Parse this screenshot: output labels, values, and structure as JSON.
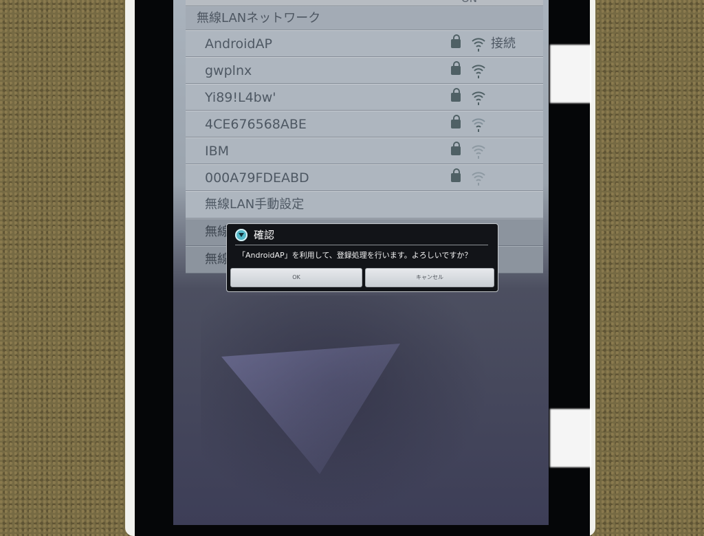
{
  "status": {
    "top_value": "ON"
  },
  "wifi_section": {
    "header": "無線LANネットワーク"
  },
  "networks": [
    {
      "name": "AndroidAP",
      "status": "接続"
    },
    {
      "name": "gwplnx"
    },
    {
      "name": "Yi89!L4bw'"
    },
    {
      "name": "4CE676568ABE"
    },
    {
      "name": "IBM"
    },
    {
      "name": "000A79FDEABD"
    }
  ],
  "manual_setup": {
    "label": "無線LAN手動設定"
  },
  "dimmed_rows": [
    {
      "label": "無線"
    },
    {
      "label": "無線"
    }
  ],
  "dialog": {
    "title": "確認",
    "message": "「AndroidAP」を利用して、登録処理を行います。よろしいですか？",
    "ok_label": "OK",
    "cancel_label": "キャンセル"
  },
  "icons": {
    "dialog": "info-circle-icon",
    "network_secure": "lock-icon",
    "signal": "wifi-signal-icon"
  },
  "colors": {
    "dialog_background": "#121418",
    "screen_panel": "#aeb6bf",
    "accent_icon": "#54b9c9"
  }
}
